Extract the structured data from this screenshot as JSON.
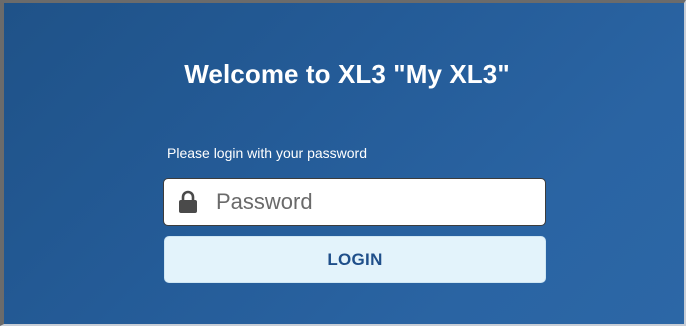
{
  "login": {
    "title": "Welcome to XL3 \"My XL3\"",
    "prompt": "Please login with your password",
    "password_placeholder": "Password",
    "password_value": "",
    "password_icon": "lock-icon",
    "login_label": "LOGIN"
  },
  "colors": {
    "background": "#245b97",
    "button_bg": "#e3f3fb",
    "button_text": "#1f4f8a",
    "title_text": "#ffffff"
  }
}
